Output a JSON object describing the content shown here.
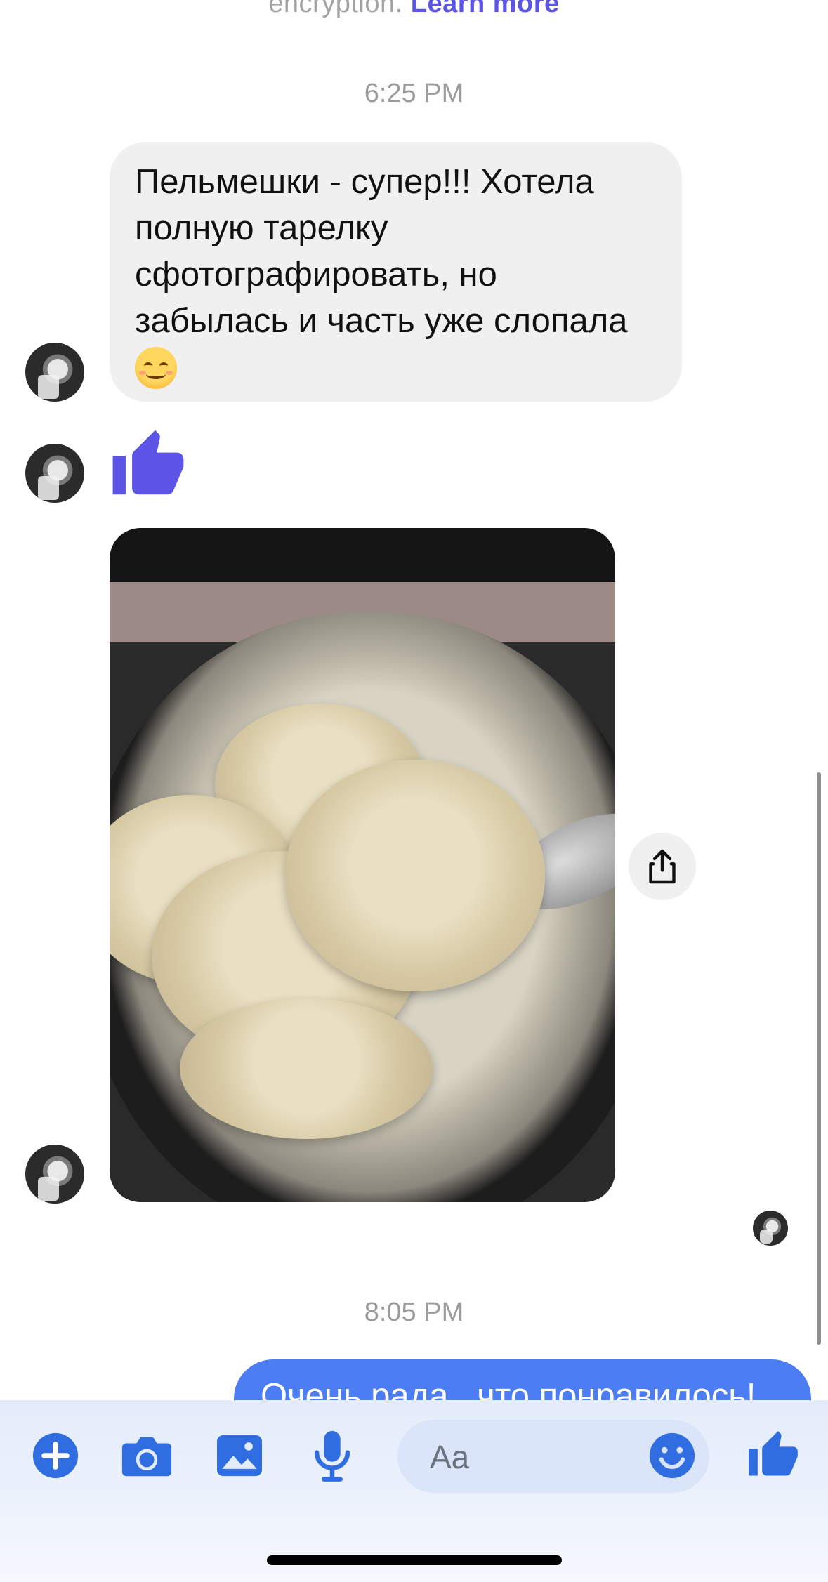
{
  "encryption_notice": {
    "text": "encryption.",
    "link": "Learn more"
  },
  "timestamps": [
    "6:25 PM",
    "8:05 PM"
  ],
  "incoming_message": {
    "lines": [
      "Пельмешки - супер!!!  Хотела",
      "полную тарелку",
      "сфотографировать, но",
      "забылась и часть уже слопала"
    ],
    "emoji": "smiling-face-emoji"
  },
  "thumbs_up_reaction": "thumbs-up-icon",
  "photo": {
    "subject": "dumplings-photo"
  },
  "outgoing_message": {
    "text": "Очень рада , что понравилось!"
  },
  "composer": {
    "placeholder": "Aa"
  },
  "colors": {
    "accent": "#4c7df2",
    "like": "#5b54e6",
    "incoming_bubble": "#f0f0f0",
    "timestamp": "#9b9b9b"
  },
  "icons": [
    "plus-icon",
    "camera-icon",
    "gallery-icon",
    "microphone-icon",
    "emoji-icon",
    "like-icon",
    "share-icon"
  ]
}
